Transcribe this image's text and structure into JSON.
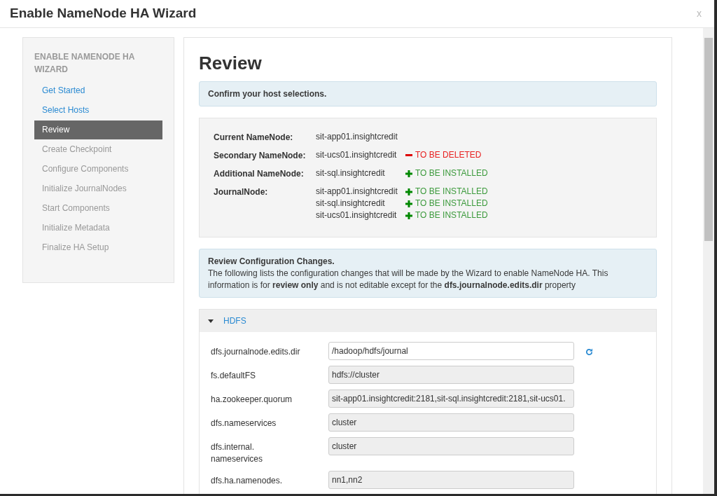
{
  "window": {
    "title": "Enable NameNode HA Wizard",
    "close": "x"
  },
  "sidebar": {
    "title": "ENABLE NAMENODE HA WIZARD",
    "items": [
      {
        "label": "Get Started",
        "disabled": false,
        "selected": false
      },
      {
        "label": "Select Hosts",
        "disabled": false,
        "selected": false
      },
      {
        "label": "Review",
        "disabled": false,
        "selected": true
      },
      {
        "label": "Create Checkpoint",
        "disabled": true,
        "selected": false
      },
      {
        "label": "Configure Components",
        "disabled": true,
        "selected": false
      },
      {
        "label": "Initialize JournalNodes",
        "disabled": true,
        "selected": false
      },
      {
        "label": "Start Components",
        "disabled": true,
        "selected": false
      },
      {
        "label": "Initialize Metadata",
        "disabled": true,
        "selected": false
      },
      {
        "label": "Finalize HA Setup",
        "disabled": true,
        "selected": false
      }
    ]
  },
  "heading": "Review",
  "confirm_alert": "Confirm your host selections.",
  "hosts": [
    {
      "label": "Current NameNode:",
      "entries": [
        {
          "host": "sit-app01.insightcredit"
        }
      ]
    },
    {
      "label": "Secondary NameNode:",
      "entries": [
        {
          "host": "sit-ucs01.insightcredit",
          "kind": "delete",
          "action": "TO BE DELETED"
        }
      ]
    },
    {
      "label": "Additional NameNode:",
      "entries": [
        {
          "host": "sit-sql.insightcredit",
          "kind": "install",
          "action": "TO BE INSTALLED"
        }
      ]
    },
    {
      "label": "JournalNode:",
      "entries": [
        {
          "host": "sit-app01.insightcredit",
          "kind": "install",
          "action": "TO BE INSTALLED"
        },
        {
          "host": "sit-sql.insightcredit",
          "kind": "install",
          "action": "TO BE INSTALLED"
        },
        {
          "host": "sit-ucs01.insightcredit",
          "kind": "install",
          "action": "TO BE INSTALLED"
        }
      ]
    }
  ],
  "config_alert": {
    "title": "Review Configuration Changes.",
    "text": "The following lists the configuration changes that will be made by the Wizard to enable NameNode HA. This information is for **review only** and is not editable except for the **dfs.journalnode.edits.dir** property"
  },
  "section": {
    "title": "HDFS",
    "expanded": true,
    "properties": [
      {
        "label": "dfs.journalnode.edits.dir",
        "value": "/hadoop/hdfs/journal",
        "disabled": false
      },
      {
        "label": "fs.defaultFS",
        "value": "hdfs://cluster",
        "disabled": true
      },
      {
        "label": "ha.zookeeper.quorum",
        "value": "sit-app01.insightcredit:2181,sit-sql.insightcredit:2181,sit-ucs01.",
        "disabled": true
      },
      {
        "label": "dfs.nameservices",
        "value": "cluster",
        "disabled": true
      },
      {
        "label": "dfs.internal.\nnameservices",
        "value": "cluster",
        "disabled": true
      },
      {
        "label": "dfs.ha.namenodes.",
        "value": "nn1,nn2",
        "disabled": true
      }
    ]
  }
}
